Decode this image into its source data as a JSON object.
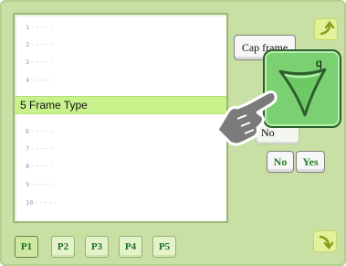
{
  "menu": {
    "items": [
      {
        "num": "1",
        "text": "-----"
      },
      {
        "num": "2",
        "text": "-----"
      },
      {
        "num": "3",
        "text": "-----"
      },
      {
        "num": "4",
        "text": "-----"
      },
      {
        "num": "5",
        "text": "5 Frame Type",
        "selected": true
      },
      {
        "num": "6",
        "text": "-----"
      },
      {
        "num": "7",
        "text": "-----"
      },
      {
        "num": "8",
        "text": "-----"
      },
      {
        "num": "9",
        "text": "-----"
      },
      {
        "num": "10",
        "text": "-----"
      }
    ]
  },
  "option_button": {
    "label": "Cap frame"
  },
  "zoom_icon": {
    "label": "q"
  },
  "popup": {
    "text": "No"
  },
  "confirm": {
    "no_label": "No",
    "yes_label": "Yes"
  },
  "pages": {
    "p1": "P1",
    "p2": "P2",
    "p3": "P3",
    "p4": "P4",
    "p5": "P5"
  },
  "colors": {
    "panel_bg": "#c8e0a4",
    "selected_row": "#c8f28c",
    "zoom_bg": "#7bd072",
    "yes_no_text": "#2a7f2a"
  },
  "icons": {
    "up": "arrow-up-icon",
    "down": "arrow-down-icon",
    "zoom": "down-triangle-icon",
    "pointer": "hand-pointer-icon"
  }
}
